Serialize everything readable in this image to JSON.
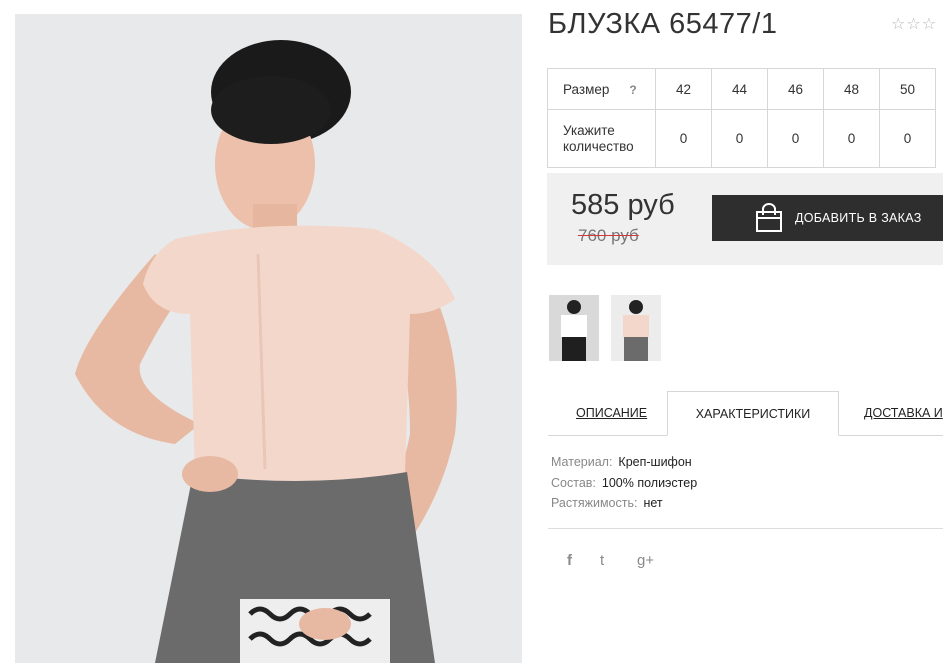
{
  "product": {
    "title": "БЛУЗКА 65477/1",
    "rating_stars": "☆☆☆",
    "photo_alt": "blouse-model-photo"
  },
  "sizes": {
    "size_label": "Размер",
    "help": "?",
    "qty_label_line1": "Укажите",
    "qty_label_line2": "количество",
    "values": [
      "42",
      "44",
      "46",
      "48",
      "50"
    ],
    "quantities": [
      "0",
      "0",
      "0",
      "0",
      "0"
    ]
  },
  "price": {
    "current": "585 руб",
    "old": "760 руб",
    "add_to_cart": "ДОБАВИТЬ В ЗАКАЗ"
  },
  "tabs": {
    "description": "ОПИСАНИЕ",
    "characteristics": "ХАРАКТЕРИСТИКИ",
    "delivery": "ДОСТАВКА И"
  },
  "specs": [
    {
      "key": "Материал:",
      "value": "Креп-шифон"
    },
    {
      "key": "Состав:",
      "value": "100% полиэстер"
    },
    {
      "key": "Растяжимость:",
      "value": "нет"
    }
  ],
  "social": {
    "facebook": "f",
    "twitter": "t",
    "google": "g+"
  },
  "colors": {
    "button_bg": "#2e2e2e",
    "price_box_bg": "#f0f0f0",
    "strike_red": "#d23a3a",
    "blouse": "#f3d7cb",
    "skirt": "#6b6b6b"
  }
}
